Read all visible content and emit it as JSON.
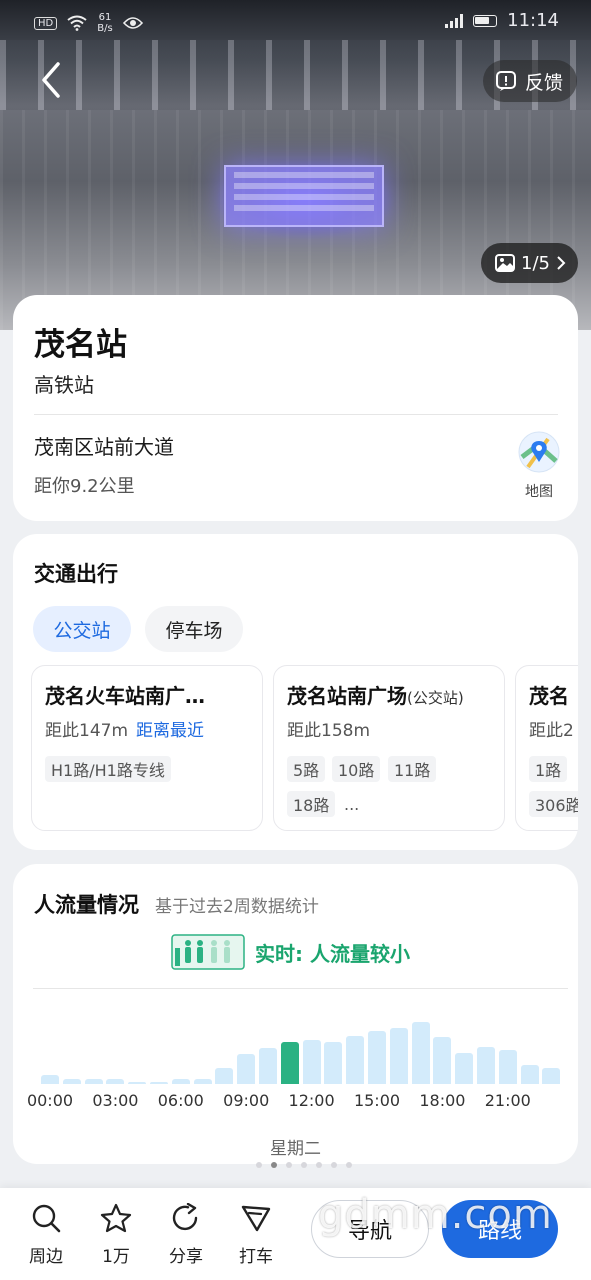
{
  "status_bar": {
    "hd": "HD",
    "speed_value": "61",
    "speed_unit": "B/s",
    "time": "11:14"
  },
  "header": {
    "feedback_label": "反馈",
    "photo_counter": "1/5"
  },
  "poi": {
    "name": "茂名站",
    "type": "高铁站",
    "address": "茂南区站前大道",
    "distance": "距你9.2公里",
    "map_label": "地图"
  },
  "transit": {
    "title": "交通出行",
    "tabs": [
      {
        "label": "公交站",
        "active": true
      },
      {
        "label": "停车场",
        "active": false
      }
    ],
    "stops": [
      {
        "name": "茂名火车站南广…",
        "distance": "距此147m",
        "tag": "距离最近",
        "routes": [
          "H1路/H1路专线"
        ]
      },
      {
        "name": "茂名站南广场",
        "suffix": "(公交站)",
        "distance": "距此158m",
        "routes": [
          "5路",
          "10路",
          "11路",
          "18路",
          "..."
        ]
      },
      {
        "name": "茂名",
        "distance": "距此2",
        "routes": [
          "1路",
          "306路"
        ]
      }
    ]
  },
  "flow": {
    "title": "人流量情况",
    "subtitle": "基于过去2周数据统计",
    "realtime_text": "实时: 人流量较小",
    "weekday": "星期二",
    "page_dots": 7,
    "active_dot": 1,
    "colors": {
      "bar": "#d3ebfb",
      "current": "#2bb283"
    }
  },
  "chart_data": {
    "type": "bar",
    "categories": [
      "0",
      "1",
      "2",
      "3",
      "4",
      "5",
      "6",
      "7",
      "8",
      "9",
      "10",
      "11",
      "12",
      "13",
      "14",
      "15",
      "16",
      "17",
      "18",
      "19",
      "20",
      "21",
      "22",
      "23"
    ],
    "values": [
      6,
      3,
      2,
      2,
      0,
      0,
      1,
      2,
      10,
      19,
      23,
      27,
      28,
      27,
      31,
      34,
      36,
      40,
      30,
      20,
      24,
      22,
      12,
      10
    ],
    "current_index": 11,
    "tick_labels": [
      "00:00",
      "03:00",
      "06:00",
      "09:00",
      "12:00",
      "15:00",
      "18:00",
      "21:00"
    ],
    "ylim": [
      0,
      45
    ]
  },
  "bottom_bar": {
    "actions": [
      {
        "label": "周边"
      },
      {
        "label": "1万"
      },
      {
        "label": "分享"
      },
      {
        "label": "打车"
      }
    ],
    "nav_label": "导航",
    "route_label": "路线"
  },
  "watermark": "gdmm.com"
}
